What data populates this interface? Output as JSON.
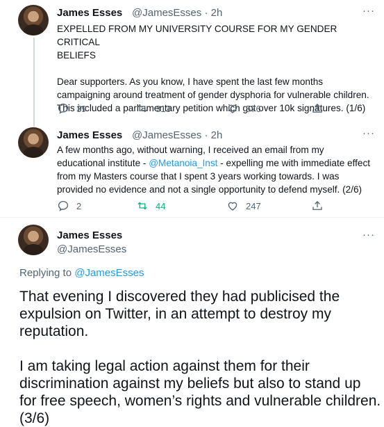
{
  "tweet1": {
    "name": "James Esses",
    "handle": "@JamesEsses",
    "time": "· 2h",
    "more": "···",
    "text": "EXPELLED FROM MY UNIVERSITY COURSE FOR MY GENDER CRITICAL\nBELIEFS\n\nDear supporters. As you know, I have spent the last few months\ncampaigning around treatment of gender dysphoria for vulnerable children.\nThis included a parliamentary petition which got over 10k signatures. (1/6)",
    "replies": "39",
    "retweets": "313",
    "likes": "576"
  },
  "tweet2": {
    "name": "James Esses",
    "handle": "@JamesEsses",
    "time": "· 2h",
    "more": "···",
    "text_before": "A few months ago, without warning, I received an email from my\neducational institute - ",
    "mention": "@Metanoia_Inst",
    "text_after": " - expelling me with immediate effect\nfrom my Masters course that I spent 3 years working towards. I was\nprovided no evidence and not a single opportunity to defend myself. (2/6)",
    "replies": "2",
    "retweets": "44",
    "likes": "247"
  },
  "tweet3": {
    "name": "James Esses",
    "handle": "@JamesEsses",
    "more": "···",
    "replying_prefix": "Replying to ",
    "replying_handle": "@JamesEsses",
    "text": "That evening I discovered they had publicised the\nexpulsion on Twitter, in an attempt to destroy my\nreputation.\n\nI am taking legal action against them for their\ndiscrimination against my beliefs but also to stand up\nfor free speech, women’s rights and vulnerable children.\n(3/6)"
  },
  "colors": {
    "link": "#1d9bf0",
    "retweet_active": "#00ba7c",
    "muted": "#536471"
  },
  "icons": [
    "reply-icon",
    "retweet-icon",
    "like-icon",
    "share-icon",
    "more-icon"
  ]
}
